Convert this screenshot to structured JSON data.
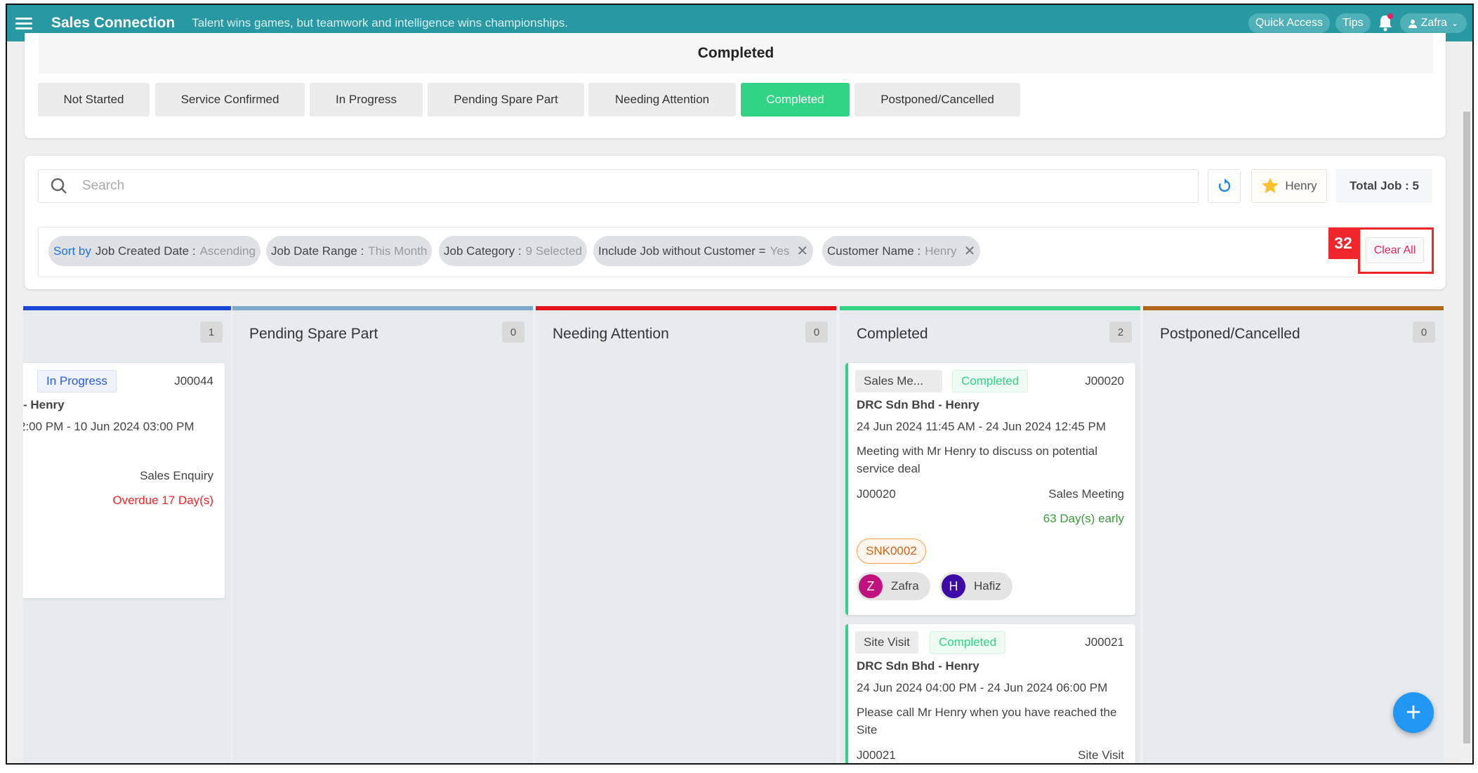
{
  "header": {
    "title": "Sales Connection",
    "tagline": "Talent wins games, but teamwork and intelligence wins championships.",
    "quick_access": "Quick Access",
    "tips": "Tips",
    "user": "Zafra",
    "brand_color": "#2899a3"
  },
  "status_panel": {
    "title": "Completed",
    "tabs": [
      "Not Started",
      "Service Confirmed",
      "In Progress",
      "Pending Spare Part",
      "Needing Attention",
      "Completed",
      "Postponed/Cancelled"
    ],
    "active_tab": "Completed"
  },
  "search": {
    "placeholder": "Search",
    "favorite_label": "Henry",
    "total_job": "Total Job : 5"
  },
  "filters": {
    "sort_by": "Sort by",
    "sort_field": "Job Created Date :",
    "sort_value": "Ascending",
    "date_range_label": "Job Date Range :",
    "date_range_value": "This Month",
    "category_label": "Job Category :",
    "category_value": "9 Selected",
    "include_label": "Include Job without Customer =",
    "include_value": "Yes",
    "customer_label": "Customer Name :",
    "customer_value": "Henry",
    "annotation_badge": "32",
    "clear_all": "Clear All"
  },
  "columns": [
    {
      "title": "",
      "count": "1",
      "color": "#1a47d6",
      "cards": [
        {
          "status": "In Progress",
          "job_id": "J00044",
          "customer": "- Henry",
          "datetime": "2:00 PM - 10 Jun 2024 03:00 PM",
          "category": "Sales Enquiry",
          "due": "Overdue 17 Day(s)"
        }
      ]
    },
    {
      "title": "Pending Spare Part",
      "count": "0",
      "color": "#7ea9cc"
    },
    {
      "title": "Needing Attention",
      "count": "0",
      "color": "#e3131b"
    },
    {
      "title": "Completed",
      "count": "2",
      "color": "#31d384",
      "cards": [
        {
          "category_chip": "Sales Me...",
          "status": "Completed",
          "job_id": "J00020",
          "customer": "DRC Sdn Bhd - Henry",
          "datetime": "24 Jun 2024 11:45 AM - 24 Jun 2024 12:45 PM",
          "description": "Meeting with Mr Henry to discuss on potential service deal",
          "ref": "J00020",
          "category": "Sales Meeting",
          "due": "63 Day(s) early",
          "tag": "SNK0002",
          "assignees": [
            {
              "initial": "Z",
              "name": "Zafra",
              "color": "#c0127f"
            },
            {
              "initial": "H",
              "name": "Hafiz",
              "color": "#3d0aa8"
            }
          ]
        },
        {
          "category_chip": "Site Visit",
          "status": "Completed",
          "job_id": "J00021",
          "customer": "DRC Sdn Bhd - Henry",
          "datetime": "24 Jun 2024 04:00 PM - 24 Jun 2024 06:00 PM",
          "description": "Please call Mr Henry when you have reached the Site",
          "ref": "J00021",
          "category": "Site Visit"
        }
      ]
    },
    {
      "title": "Postponed/Cancelled",
      "count": "0",
      "color": "#b06a1a"
    }
  ],
  "fab": "+"
}
